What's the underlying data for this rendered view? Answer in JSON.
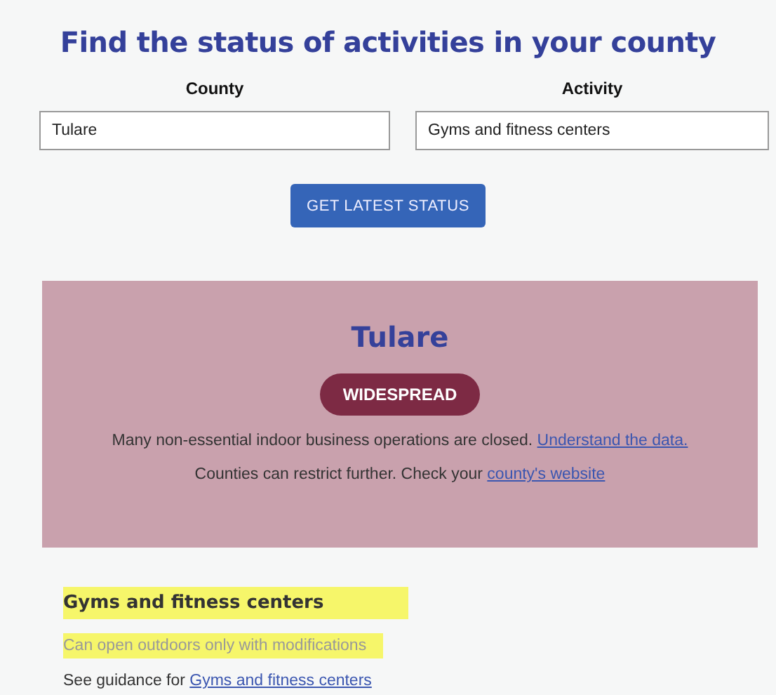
{
  "title": "Find the status of activities in your county",
  "fields": [
    {
      "label": "County",
      "value": "Tulare"
    },
    {
      "label": "Activity",
      "value": "Gyms and fitness centers"
    }
  ],
  "button": "GET LATEST STATUS",
  "result": {
    "county": "Tulare",
    "tier": "WIDESPREAD",
    "line_1": {
      "text": "Many non-essential indoor business operations are closed.",
      "link": "Understand the data."
    },
    "line_2": {
      "text": "Counties can restrict further. Check your",
      "link": "county's website"
    }
  },
  "activity": {
    "name": "Gyms and fitness centers",
    "status": "Can open outdoors only with modifications",
    "guidance": "See guidance for",
    "guidance_link": "Gyms and fitness centers"
  }
}
